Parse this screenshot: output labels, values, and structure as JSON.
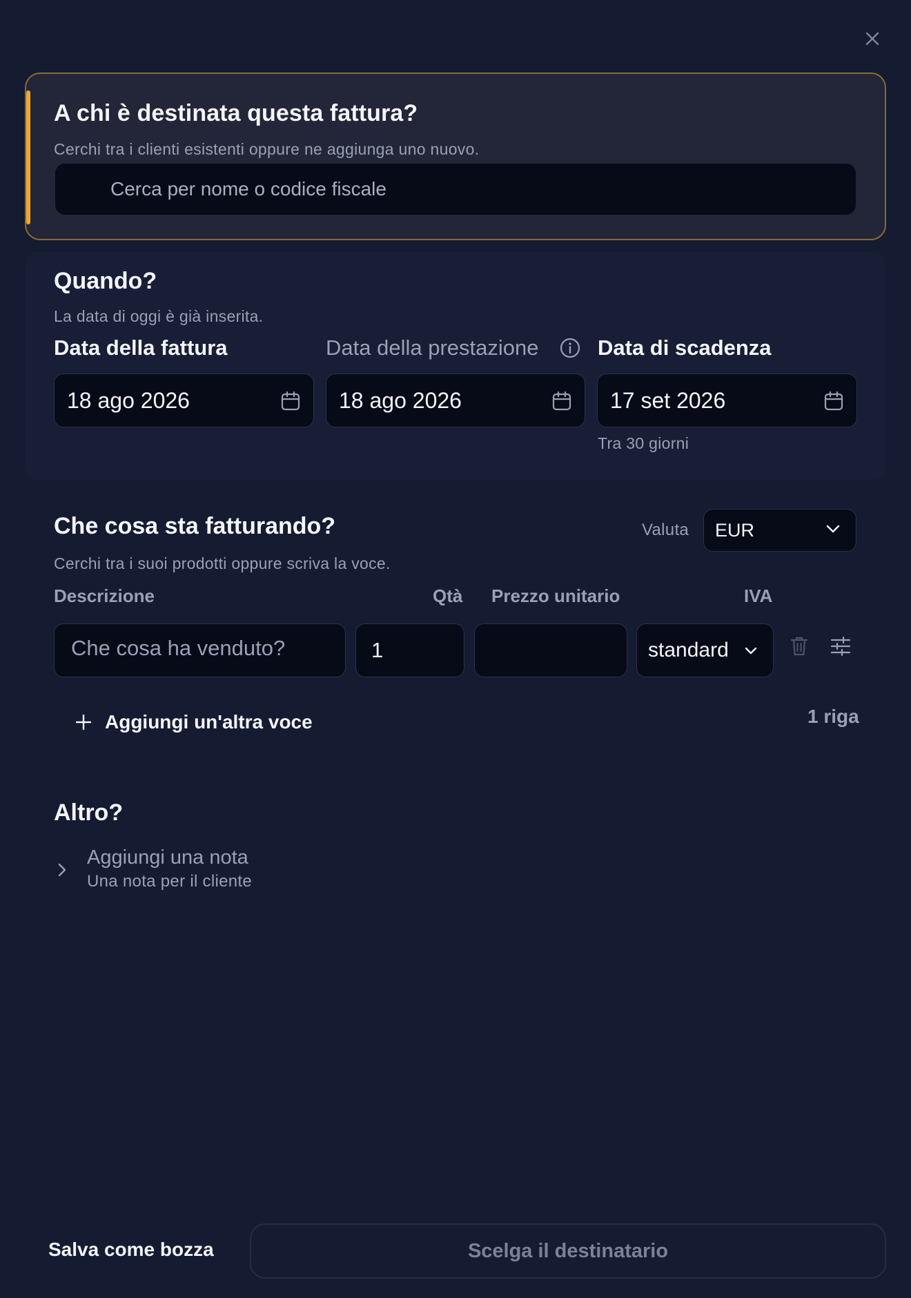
{
  "recipient": {
    "title": "A chi è destinata questa fattura?",
    "subtitle": "Cerchi tra i clienti esistenti oppure ne aggiunga uno nuovo.",
    "search_placeholder": "Cerca per nome o codice fiscale",
    "accent_color": "#f0a82c"
  },
  "when": {
    "title": "Quando?",
    "subtitle": "La data di oggi è già inserita.",
    "invoice_date_label": "Data della fattura",
    "invoice_date_value": "18 ago 2026",
    "service_date_label": "Data della prestazione",
    "service_date_value": "18 ago 2026",
    "due_date_label": "Data di scadenza",
    "due_date_value": "17 set 2026",
    "due_hint": "Tra 30 giorni"
  },
  "items": {
    "title": "Che cosa sta fatturando?",
    "subtitle": "Cerchi tra i suoi prodotti oppure scriva la voce.",
    "currency_label": "Valuta",
    "currency_value": "EUR",
    "col_description": "Descrizione",
    "col_qty": "Qtà",
    "col_price": "Prezzo unitario",
    "col_vat": "IVA",
    "rows": [
      {
        "description_placeholder": "Che cosa ha venduto?",
        "qty": "1",
        "price": "",
        "vat": "standard"
      }
    ],
    "add_label": "Aggiungi un'altra voce",
    "row_count": "1 riga"
  },
  "other": {
    "title": "Altro?",
    "note_title": "Aggiungi una nota",
    "note_subtitle": "Una nota per il cliente"
  },
  "footer": {
    "draft_label": "Salva come bozza",
    "primary_label": "Scelga il destinatario"
  },
  "icons": {
    "close": "close-icon",
    "calendar": "calendar-icon",
    "info": "info-icon",
    "chevron_down": "chevron-down-icon",
    "trash": "trash-icon",
    "sliders": "sliders-icon",
    "plus": "plus-icon",
    "chevron_right": "chevron-right-icon"
  }
}
